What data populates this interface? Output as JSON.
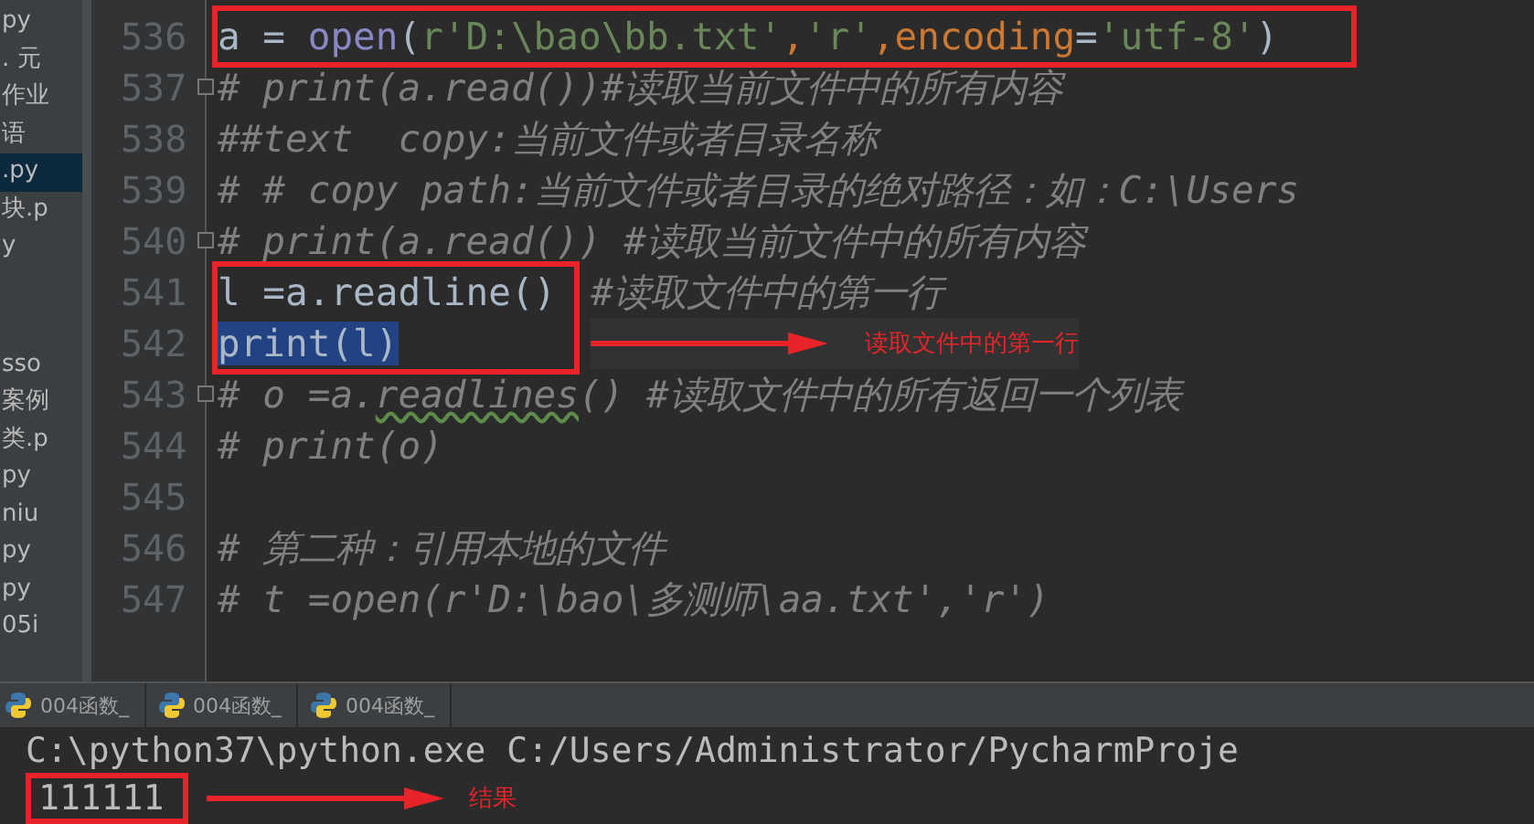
{
  "sidebar": {
    "items": [
      {
        "label": "py",
        "selected": false
      },
      {
        "label": ". 元",
        "selected": false
      },
      {
        "label": "作业",
        "selected": false
      },
      {
        "label": "语",
        "selected": false
      },
      {
        "label": ".py",
        "selected": true
      },
      {
        "label": "块.p",
        "selected": false
      },
      {
        "label": "y",
        "selected": false
      }
    ],
    "items_lower": [
      {
        "label": "sso",
        "selected": false
      },
      {
        "label": "案例",
        "selected": false
      },
      {
        "label": "类.p",
        "selected": false
      },
      {
        "label": "py",
        "selected": false
      },
      {
        "label": "niu",
        "selected": false
      },
      {
        "label": "py",
        "selected": false
      },
      {
        "label": "py",
        "selected": false
      },
      {
        "label": "05i",
        "selected": false
      }
    ]
  },
  "editor": {
    "rows": [
      {
        "kind": "boxed",
        "lines": [
          {
            "number": "536",
            "fold": false,
            "tokens": [
              {
                "text": "a = ",
                "kind": "plain"
              },
              {
                "text": "open",
                "kind": "builtin"
              },
              {
                "text": "(",
                "kind": "plain"
              },
              {
                "text": "r'D:\\bao\\bb.txt'",
                "kind": "string"
              },
              {
                "text": ",",
                "kind": "param"
              },
              {
                "text": "'r'",
                "kind": "string"
              },
              {
                "text": ",",
                "kind": "param"
              },
              {
                "text": "encoding",
                "kind": "param"
              },
              {
                "text": "=",
                "kind": "plain"
              },
              {
                "text": "'utf-8'",
                "kind": "string"
              },
              {
                "text": ")",
                "kind": "plain"
              }
            ]
          }
        ]
      },
      {
        "kind": "line",
        "number": "537",
        "fold": true,
        "tokens": [
          {
            "text": "# print(a.read())#读取当前文件中的所有内容",
            "kind": "comment"
          }
        ]
      },
      {
        "kind": "line",
        "number": "538",
        "fold": false,
        "tokens": [
          {
            "text": "##text  copy:当前文件或者目录名称",
            "kind": "comment"
          }
        ]
      },
      {
        "kind": "line",
        "number": "539",
        "fold": false,
        "tokens": [
          {
            "text": "# # copy path:当前文件或者目录的绝对路径：如：C:\\Users",
            "kind": "comment"
          }
        ]
      },
      {
        "kind": "line",
        "number": "540",
        "fold": true,
        "tokens": [
          {
            "text": "# print(a.read()) #读取当前文件中的所有内容",
            "kind": "comment"
          }
        ]
      },
      {
        "kind": "boxed",
        "callout": "读取文件中的第一行",
        "lines": [
          {
            "number": "541",
            "fold": false,
            "tokens": [
              {
                "text": "l =a.readline()",
                "kind": "plain"
              }
            ],
            "trailing": [
              {
                "text": "#读取文件中的第一行",
                "kind": "comment"
              }
            ]
          },
          {
            "number": "542",
            "fold": false,
            "current": true,
            "tokens": [
              {
                "text": "print(l)",
                "kind": "plain",
                "highlighted": true
              }
            ]
          }
        ]
      },
      {
        "kind": "line",
        "number": "543",
        "fold": true,
        "tokens": [
          {
            "text": "# o =a.",
            "kind": "comment"
          },
          {
            "text": "readlines",
            "kind": "comment",
            "underlined": true
          },
          {
            "text": "() #读取文件中的所有返回一个列表",
            "kind": "comment"
          }
        ]
      },
      {
        "kind": "line",
        "number": "544",
        "fold": false,
        "tokens": [
          {
            "text": "# print(o)",
            "kind": "comment"
          }
        ]
      },
      {
        "kind": "line",
        "number": "545",
        "fold": false,
        "tokens": []
      },
      {
        "kind": "line",
        "number": "546",
        "fold": false,
        "tokens": [
          {
            "text": "# 第二种：引用本地的文件",
            "kind": "comment"
          }
        ]
      },
      {
        "kind": "line",
        "number": "547",
        "fold": false,
        "tokens": [
          {
            "text": "# t =open(r'D:\\bao\\多测师\\aa.txt','r')",
            "kind": "comment"
          }
        ]
      }
    ]
  },
  "run_tabs": [
    {
      "label": "004函数_",
      "selected": false
    },
    {
      "label": "004函数_",
      "selected": false
    },
    {
      "label": "004函数_",
      "selected": false
    }
  ],
  "console": {
    "lines": [
      {
        "text": "C:\\python37\\python.exe C:/Users/Administrator/PycharmProje",
        "boxed": false
      },
      {
        "text": "111111",
        "boxed": true,
        "callout": "结果"
      }
    ]
  }
}
